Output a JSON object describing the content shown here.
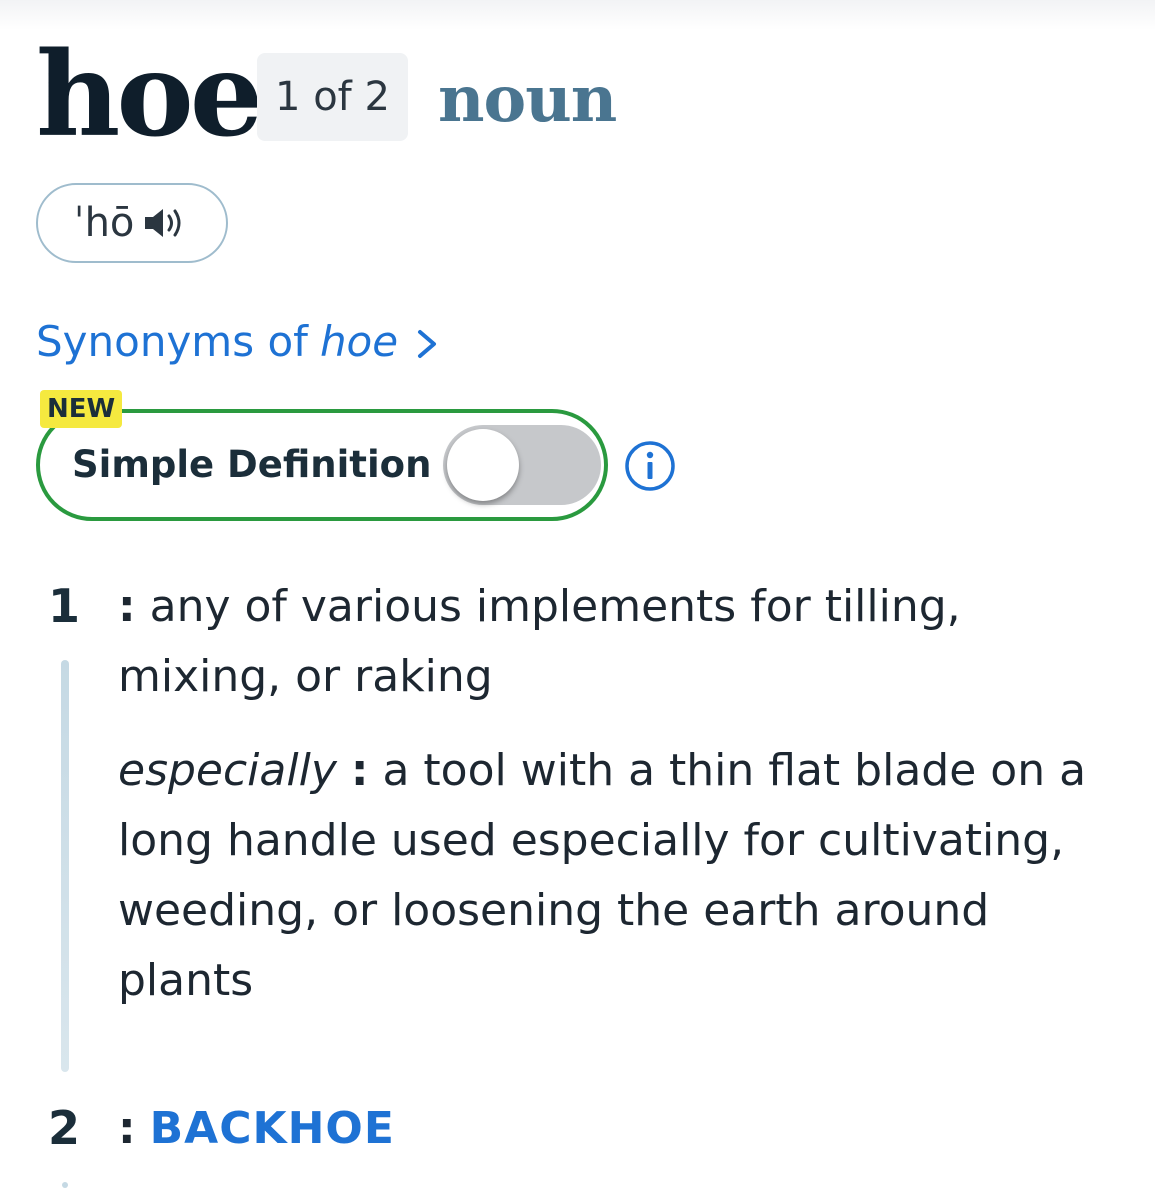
{
  "entry": {
    "headword": "hoe",
    "homograph": "1 of 2",
    "part_of_speech": "noun",
    "pronunciation": "ˈhō",
    "speaker_icon": "speaker-icon"
  },
  "synonyms": {
    "prefix": "Synonyms of",
    "word": "hoe",
    "chevron_icon": "chevron-right-icon"
  },
  "simple_definition": {
    "badge": "NEW",
    "label": "Simple Definition",
    "toggle_on": false,
    "info_icon": "info-icon",
    "border_color": "#2a9a3f",
    "badge_color": "#f5e93f"
  },
  "senses": [
    {
      "number": "1",
      "colon": ":",
      "definition": "any of various implements for tilling, mixing, or raking",
      "subsense": {
        "label": "especially",
        "colon": ":",
        "definition": "a tool with a thin flat blade on a long handle used especially for cultivating, weeding, or loosening the earth around plants"
      }
    },
    {
      "number": "2",
      "colon": ":",
      "cross_reference": "BACKHOE"
    }
  ],
  "colors": {
    "link": "#1e72d4",
    "part_of_speech": "#4a7590",
    "headword": "#0f1e2b"
  }
}
